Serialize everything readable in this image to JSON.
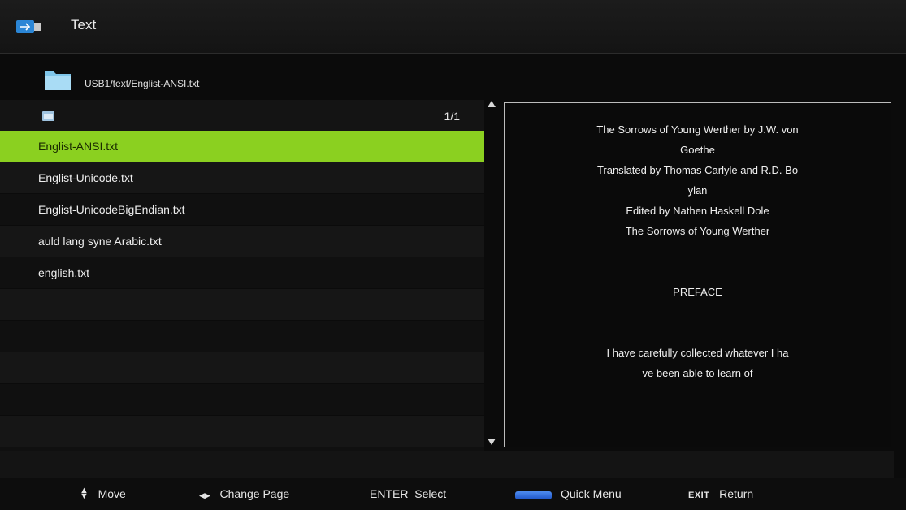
{
  "header": {
    "title": "Text",
    "icon": "usb-icon"
  },
  "path": {
    "text": "USB1/text/Englist-ANSI.txt",
    "icon": "folder-icon"
  },
  "list": {
    "page_indicator": "1/1",
    "selected_index": 0,
    "items": [
      "Englist-ANSI.txt",
      "Englist-Unicode.txt",
      "Englist-UnicodeBigEndian.txt",
      "auld lang syne Arabic.txt",
      "english.txt"
    ]
  },
  "preview": {
    "lines_top": [
      "The Sorrows of Young Werther by J.W. von",
      "Goethe",
      "Translated by Thomas Carlyle and R.D. Bo",
      "ylan",
      "Edited by Nathen Haskell Dole",
      "The Sorrows of Young Werther"
    ],
    "heading": "PREFACE",
    "lines_bottom": [
      "I have carefully collected whatever I ha",
      "ve been able to learn of"
    ]
  },
  "footer": {
    "move_label": "Move",
    "change_page_label": "Change Page",
    "enter_key": "ENTER",
    "select_label": "Select",
    "quick_menu_label": "Quick Menu",
    "exit_key": "EXIT",
    "return_label": "Return"
  },
  "colors": {
    "selected_row": "#8bd020",
    "quick_menu_key": "#2f6fe0"
  }
}
